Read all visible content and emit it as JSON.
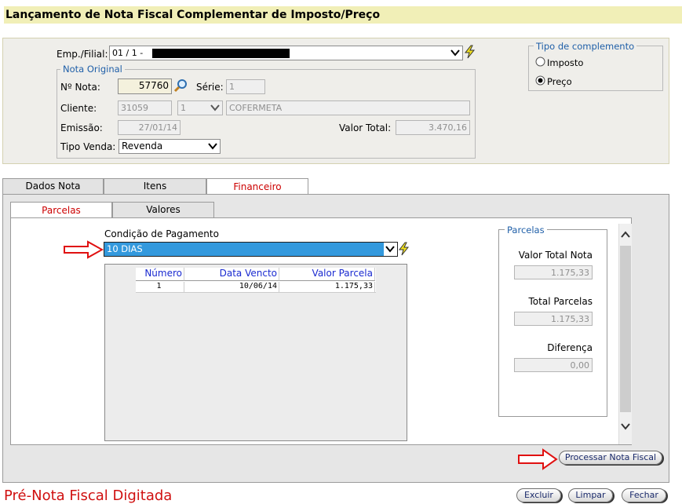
{
  "title": "Lançamento de Nota Fiscal Complementar de Imposto/Preço",
  "header": {
    "empfilial_label": "Emp./Filial:",
    "empfilial_value": "01 / 1 -",
    "nota_original_legend": "Nota Original",
    "nota_label": "Nº Nota:",
    "nota_value": "57760",
    "serie_label": "Série:",
    "serie_value": "1",
    "cliente_label": "Cliente:",
    "cliente_code": "31059",
    "cliente_loja": "1",
    "cliente_name": "COFERMETA",
    "emissao_label": "Emissão:",
    "emissao_value": "27/01/14",
    "valor_total_label": "Valor Total:",
    "valor_total_value": "3.470,16",
    "tipo_venda_label": "Tipo Venda:",
    "tipo_venda_value": "Revenda"
  },
  "tipo_complemento": {
    "legend": "Tipo de complemento",
    "options": [
      "Imposto",
      "Preço"
    ],
    "selected": "Preço"
  },
  "tabs": [
    "Dados Nota",
    "Itens",
    "Financeiro"
  ],
  "active_tab": "Financeiro",
  "subtabs": [
    "Parcelas",
    "Valores"
  ],
  "active_subtab": "Parcelas",
  "financeiro": {
    "condicao_label": "Condição de Pagamento",
    "condicao_value": "10 DIAS",
    "grid_columns": [
      "Número",
      "Data Vencto",
      "Valor Parcela"
    ],
    "grid_rows": [
      {
        "numero": "1",
        "data": "10/06/14",
        "valor": "1.175,33"
      }
    ],
    "parcelas_legend": "Parcelas",
    "valor_total_nota_label": "Valor Total Nota",
    "valor_total_nota_value": "1.175,33",
    "total_parcelas_label": "Total Parcelas",
    "total_parcelas_value": "1.175,33",
    "diferenca_label": "Diferença",
    "diferenca_value": "0,00"
  },
  "buttons": {
    "processar": "Processar Nota Fiscal",
    "excluir": "Excluir",
    "limpar": "Limpar",
    "fechar": "Fechar"
  },
  "status_text": "Pré-Nota Fiscal Digitada",
  "colors": {
    "title_bg": "#f1efb7",
    "accent_red": "#cc0000",
    "select_highlight": "#3399dd",
    "link_blue": "#1a2ad0"
  },
  "icons": {
    "lookup": "magnifier-icon",
    "refresh": "lightning-icon",
    "annotation": "red-arrow-icon"
  }
}
